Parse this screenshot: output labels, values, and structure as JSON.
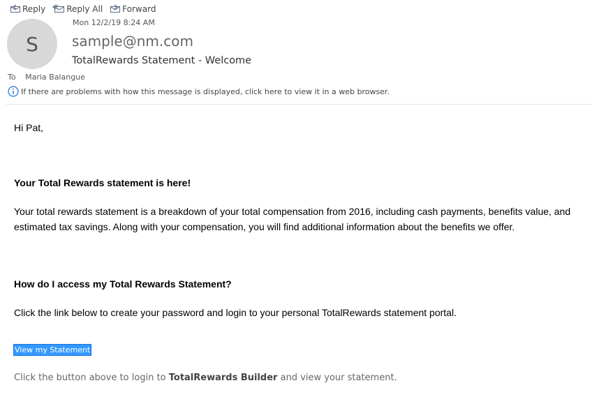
{
  "toolbar": {
    "reply": "Reply",
    "reply_all": "Reply All",
    "forward": "Forward"
  },
  "header": {
    "avatar_initial": "S",
    "date": "Mon 12/2/19 8:24 AM",
    "sender": "sample@nm.com",
    "subject": "TotalRewards Statement - Welcome",
    "to_label": "To",
    "to_name": "Maria Balangue",
    "info_text": "If there are problems with how this message is displayed, click here to view it in a web browser."
  },
  "body": {
    "greeting": "Hi Pat,",
    "heading1": "Your Total Rewards statement is here!",
    "para1": "Your total rewards statement is a breakdown of your total compensation from 2016, including cash payments, benefits value, and estimated tax savings. Along with your compensation, you will find additional information about the benefits we offer.",
    "heading2": "How do I access my Total Rewards Statement?",
    "para2": "Click the link below to create your password and login to your personal TotalRewards statement portal.",
    "link": "View my Statement",
    "footer_pre": "Click the button above to login to ",
    "footer_bold": "TotalRewards Builder",
    "footer_post": " and view your statement."
  },
  "icons": {
    "reply": "reply-icon",
    "reply_all": "reply-all-icon",
    "forward": "forward-icon",
    "info": "info-icon"
  },
  "colors": {
    "link_highlight": "#3399ff",
    "info_icon": "#1a73d9",
    "avatar_bg": "#d8d8d8"
  }
}
